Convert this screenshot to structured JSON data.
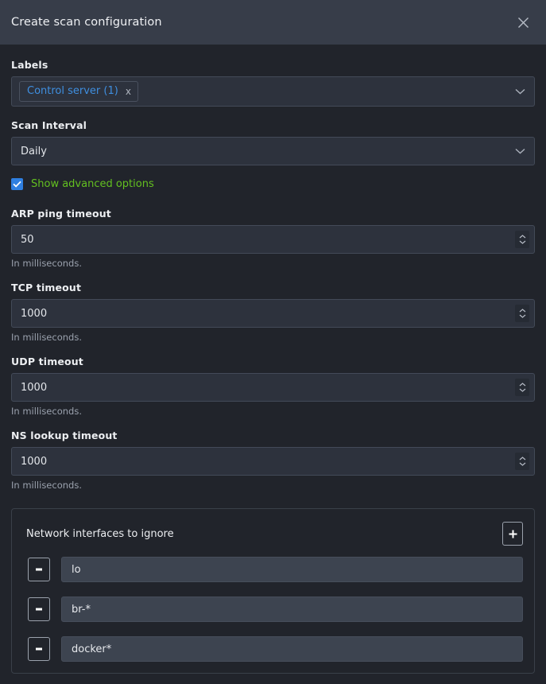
{
  "dialog": {
    "title": "Create scan configuration",
    "close_icon": "close-icon"
  },
  "labels_field": {
    "label": "Labels",
    "chips": [
      {
        "text": "Control server (1)",
        "remove_icon": "x"
      }
    ],
    "caret_icon": "chevron-down-icon"
  },
  "scan_interval": {
    "label": "Scan Interval",
    "value": "Daily",
    "caret_icon": "chevron-down-icon"
  },
  "advanced": {
    "label": "Show advanced options",
    "checked": true,
    "check_color": "#2f7fe0",
    "label_color": "#63c020"
  },
  "timeouts": [
    {
      "label": "ARP ping timeout",
      "value": "50",
      "help": "In milliseconds."
    },
    {
      "label": "TCP timeout",
      "value": "1000",
      "help": "In milliseconds."
    },
    {
      "label": "UDP timeout",
      "value": "1000",
      "help": "In milliseconds."
    },
    {
      "label": "NS lookup timeout",
      "value": "1000",
      "help": "In milliseconds."
    }
  ],
  "interfaces_panel": {
    "title": "Network interfaces to ignore",
    "add_label": "+",
    "remove_label": "-",
    "rows": [
      {
        "value": "lo"
      },
      {
        "value": "br-*"
      },
      {
        "value": "docker*"
      }
    ]
  },
  "colors": {
    "header_bg": "#373d49",
    "body_bg": "#21242b",
    "input_bg": "#2d323d",
    "text_input_bg": "#3d4450",
    "border": "#434a58",
    "accent_blue": "#3f8fe0",
    "accent_green": "#63c020"
  }
}
